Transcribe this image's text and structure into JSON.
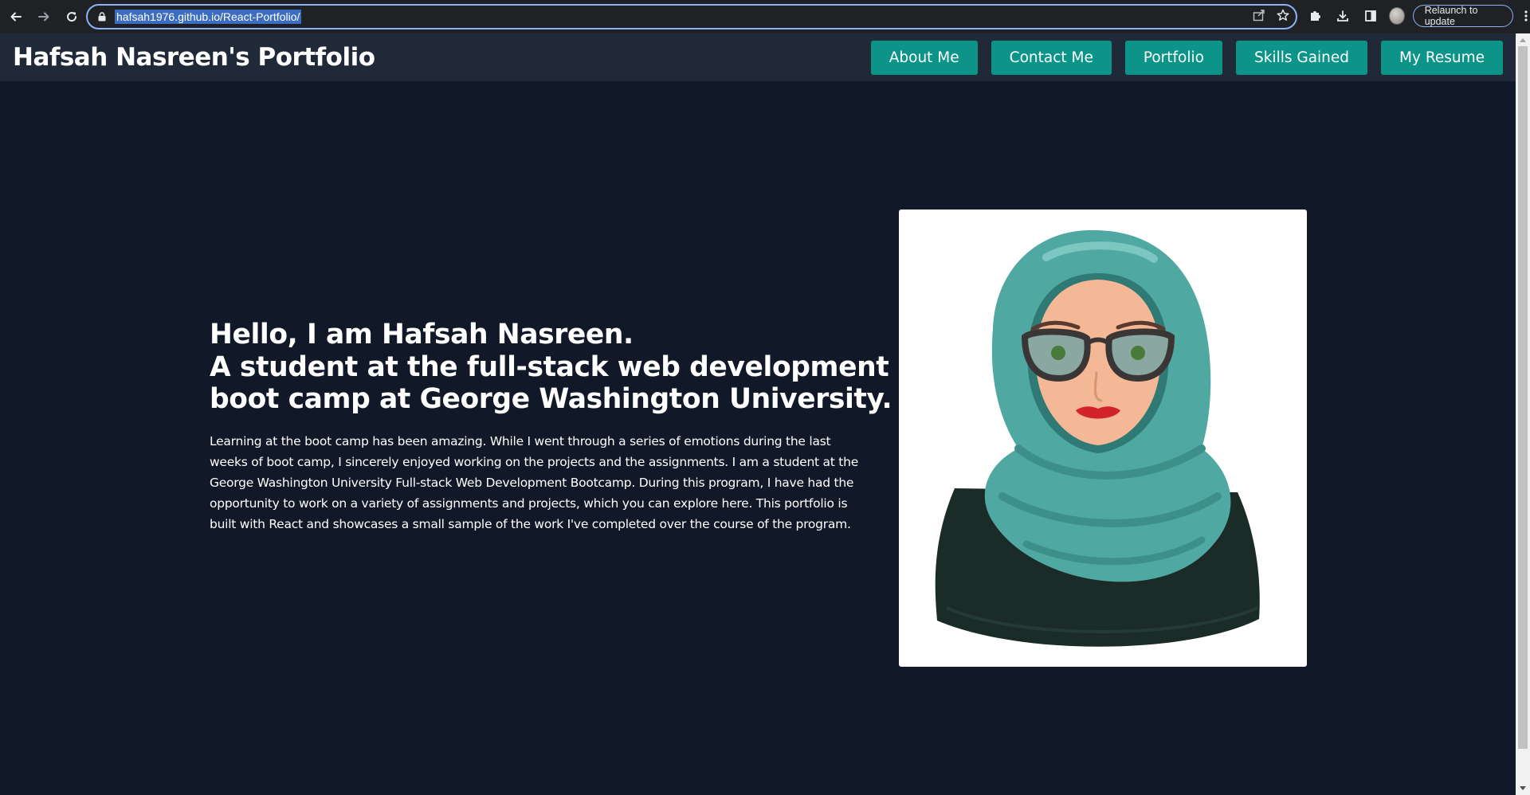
{
  "browser": {
    "url": "hafsah1976.github.io/React-Portfolio/",
    "relaunch_label": "Relaunch to update"
  },
  "header": {
    "title": "Hafsah Nasreen's Portfolio",
    "nav": [
      {
        "label": "About Me"
      },
      {
        "label": "Contact Me"
      },
      {
        "label": "Portfolio"
      },
      {
        "label": "Skills Gained"
      },
      {
        "label": "My Resume"
      }
    ]
  },
  "intro": {
    "headline_lines": [
      "Hello, I am Hafsah Nasreen.",
      "A student at the full-stack web development",
      "boot camp at George Washington University."
    ],
    "bio_lines": [
      "Learning at the boot camp has been amazing. While I went through a series of emotions during the last",
      "weeks of boot camp, I sincerely enjoyed working on the projects and the assignments. I am a student at the",
      "George Washington University Full-stack Web Development Bootcamp. During this program, I have had the",
      "opportunity to work on a variety of assignments and projects, which you can explore here. This portfolio is",
      "built with React and showcases a small sample of the work I've completed over the course of the program."
    ]
  },
  "colors": {
    "page_bg": "#111827",
    "header_bg": "#1f2937",
    "accent": "#0d9488",
    "hijab": "#4fa9a2",
    "shirt": "#1b2b27"
  },
  "icons": {
    "back": "arrow-left-icon",
    "forward": "arrow-right-icon",
    "reload": "reload-icon",
    "lock": "lock-icon",
    "share": "share-icon",
    "bookmark": "star-icon",
    "extensions": "puzzle-icon",
    "downloads": "download-icon",
    "side_panel": "side-panel-icon",
    "menu": "kebab-menu-icon"
  }
}
